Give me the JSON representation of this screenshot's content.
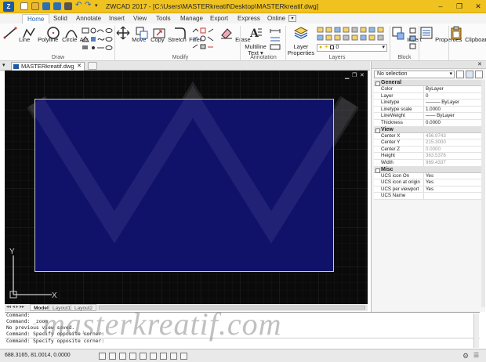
{
  "window": {
    "title": "ZWCAD 2017 - [C:\\Users\\MASTERkreatif\\Desktop\\MASTERkreatif.dwg]",
    "minimize": "–",
    "restore": "❐",
    "close": "✕"
  },
  "ribbon_tabs": [
    "Home",
    "Solid",
    "Annotate",
    "Insert",
    "View",
    "Tools",
    "Manage",
    "Export",
    "Express",
    "Online"
  ],
  "ribbon_tabs_more": "▾",
  "ribbon": {
    "draw": {
      "line": "Line",
      "polyline": "Polyline",
      "circle": "Circle",
      "arc": "Arc",
      "panel": "Draw"
    },
    "modify": {
      "move": "Move",
      "copy": "Copy",
      "stretch": "Stretch",
      "fillet": "Fillet",
      "erase": "Erase",
      "panel": "Modify"
    },
    "annotation": {
      "multiline_text_1": "Multiline",
      "multiline_text_2": "Text ▾",
      "panel": "Annotation"
    },
    "layers": {
      "layer_properties_1": "Layer",
      "layer_properties_2": "Properties",
      "current_layer": "0",
      "panel": "Layers"
    },
    "block": {
      "insert": "Insert",
      "panel": "Block"
    },
    "properties": "Properties",
    "clipboard": "Clipboard"
  },
  "document_tab": "MASTERkreatif.dwg",
  "layout_tabs": [
    "Model",
    "Layout1",
    "Layout2"
  ],
  "ucs": {
    "y": "Y",
    "x": "X"
  },
  "properties_palette": {
    "selection": "No selection",
    "sections": [
      {
        "name": "General",
        "rows": [
          {
            "key": "Color",
            "value": "ByLayer"
          },
          {
            "key": "Layer",
            "value": "0"
          },
          {
            "key": "Linetype",
            "value": "——— ByLayer"
          },
          {
            "key": "Linetype scale",
            "value": "1.0000"
          },
          {
            "key": "LineWeight",
            "value": "—— ByLayer"
          },
          {
            "key": "Thickness",
            "value": "0.0000"
          }
        ]
      },
      {
        "name": "View",
        "rows": [
          {
            "key": "Center X",
            "value": "456.9743"
          },
          {
            "key": "Center Y",
            "value": "215.3000"
          },
          {
            "key": "Center Z",
            "value": "0.0000"
          },
          {
            "key": "Height",
            "value": "363.5376"
          },
          {
            "key": "Width",
            "value": "969.4337"
          }
        ]
      },
      {
        "name": "Misc",
        "rows": [
          {
            "key": "UCS icon On",
            "value": "Yes"
          },
          {
            "key": "UCS icon at origin",
            "value": "Yes"
          },
          {
            "key": "UCS per viewport",
            "value": "Yes"
          },
          {
            "key": "UCS Name",
            "value": ""
          }
        ]
      }
    ]
  },
  "command_lines": [
    "Command:",
    "Command: _zoom",
    "No previous view saved.",
    "Command: Specify opposite corner:",
    "Command: Specify opposite corner:"
  ],
  "watermark": "masterkreatif.com",
  "status": {
    "coordinates": "688.3165, 81.0014, 0.0000"
  },
  "colors": {
    "titlebar": "#f0c21f",
    "canvas": "#0a0a0a",
    "drawing_fill": "#10126a",
    "accent": "#1f5fa8"
  }
}
